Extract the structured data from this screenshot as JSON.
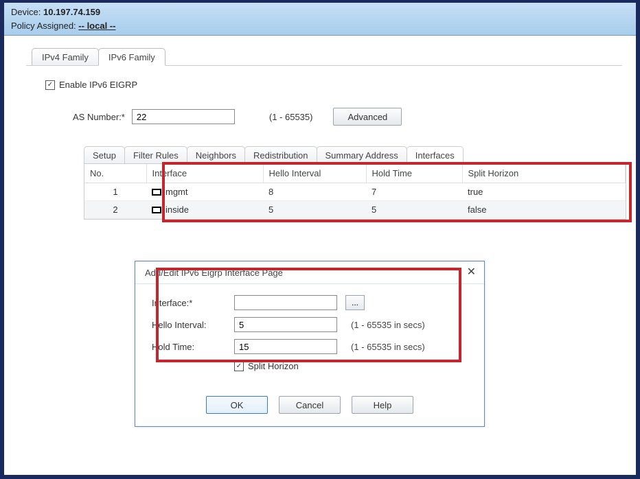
{
  "header": {
    "device_label": "Device:",
    "device_value": "10.197.74.159",
    "policy_label": "Policy Assigned:",
    "policy_value": "-- local --"
  },
  "outer_tabs": {
    "ipv4": "IPv4 Family",
    "ipv6": "IPv6 Family"
  },
  "enable_checkbox": {
    "checked_glyph": "✓",
    "label": "Enable IPv6 EIGRP"
  },
  "as_row": {
    "label": "AS Number:*",
    "value": "22",
    "range": "(1 - 65535)",
    "advanced": "Advanced"
  },
  "inner_tabs": [
    "Setup",
    "Filter Rules",
    "Neighbors",
    "Redistribution",
    "Summary Address",
    "Interfaces"
  ],
  "table": {
    "headers": {
      "no": "No.",
      "iface": "Interface",
      "hello": "Hello Interval",
      "hold": "Hold Time",
      "split": "Split Horizon"
    },
    "rows": [
      {
        "no": "1",
        "iface": "mgmt",
        "hello": "8",
        "hold": "7",
        "split": "true"
      },
      {
        "no": "2",
        "iface": "inside",
        "hello": "5",
        "hold": "5",
        "split": "false"
      }
    ]
  },
  "dialog": {
    "title": "Add/Edit IPv6 Eigrp Interface Page",
    "close": "✕",
    "interface_label": "Interface:*",
    "interface_value": "",
    "ellipsis": "...",
    "hello_label": "Hello Interval:",
    "hello_value": "5",
    "hold_label": "Hold Time:",
    "hold_value": "15",
    "range_hint": "(1 - 65535 in secs)",
    "split_label": "Split Horizon",
    "ok": "OK",
    "cancel": "Cancel",
    "help": "Help"
  }
}
